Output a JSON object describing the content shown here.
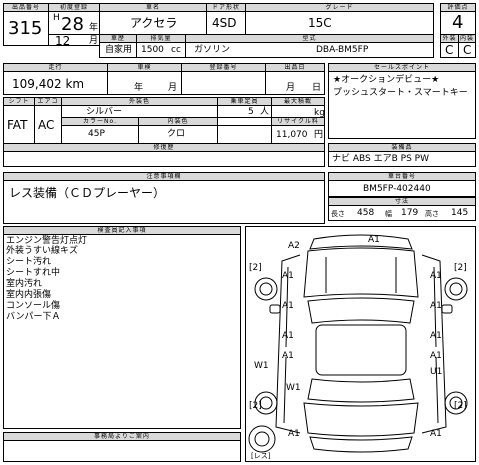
{
  "header": {
    "lot_label": "出品番号",
    "lot_value": "315",
    "first_reg_label": "初度登録",
    "era": "H",
    "year": "28",
    "year_unit": "年",
    "month": "12",
    "month_unit": "月",
    "car_name_label": "車名",
    "car_name": "アクセラ",
    "doors_label": "ドア形状",
    "doors": "4SD",
    "grade_label": "グレード",
    "grade": "15C",
    "score_label": "評価点",
    "score": "4",
    "body_type_label": "車歴",
    "body_type": "自家用",
    "displacement_label": "排気量",
    "displacement": "1500",
    "displacement_unit": "cc",
    "fuel": "ガソリン",
    "model_label": "型式",
    "model": "DBA-BM5FP",
    "ext_label": "外装",
    "int_label": "内装",
    "ext_grade": "C",
    "int_grade": "C"
  },
  "row2": {
    "mileage_label": "走行",
    "mileage": "109,402 km",
    "shaken_label": "車検",
    "shaken_year_unit": "年",
    "shaken_month_unit": "月",
    "reg_no_label": "登録番号",
    "auction_date_label": "出品日",
    "auction_day_unit": "日",
    "auction_month_unit": "月",
    "sales_points_label": "セールスポイント",
    "sales_point_1": "★オークションデビュー★",
    "sales_point_2": "プッシュスタート・スマートキー"
  },
  "row3": {
    "shift_label": "シフト",
    "ac_label": "エアコン",
    "shift": "FAT",
    "ac": "AC",
    "color_label": "外装色",
    "color": "シルバー",
    "capacity_label": "乗車定員",
    "capacity": "5",
    "capacity_unit": "人",
    "load_label": "最大積載",
    "load_unit": "kg",
    "color_no_label": "カラーNo.",
    "color_no": "45P",
    "interior_color_label": "内装色",
    "interior_color": "クロ",
    "recycle_label": "リサイクル料",
    "recycle": "11,070",
    "recycle_unit": "円"
  },
  "equipment": {
    "label": "装備品",
    "value": "ナビ ABS エアB PS PW",
    "history_label": "修復歴",
    "notes_label": "注意事項欄",
    "notes": "レス装備（ＣＤプレーヤー）"
  },
  "chassis": {
    "label": "車台番号",
    "value": "BM5FP-402440",
    "size_label": "寸法",
    "length_label": "長さ",
    "length": "458",
    "width_label": "幅",
    "width": "179",
    "height_label": "高さ",
    "height": "145"
  },
  "inspector": {
    "label": "検査員記入事項",
    "notes": [
      "エンジン警告灯点灯",
      "外装うすい線キズ",
      "シート汚れ",
      "シートすれ中",
      "室内汚れ",
      "室内内張傷",
      "コンソール傷",
      "バンパー下Ａ"
    ]
  },
  "office": {
    "label": "事務局よりご案内"
  },
  "diagram": {
    "marks": [
      "A2",
      "A1",
      "[2]",
      "A1",
      "[2]",
      "A1",
      "A1",
      "A1",
      "A1",
      "A1",
      "A1",
      "W1",
      "W1",
      "A1",
      "U1",
      "A1",
      "A1",
      "[2]",
      "[2]"
    ],
    "tire_label": "[レス]"
  }
}
